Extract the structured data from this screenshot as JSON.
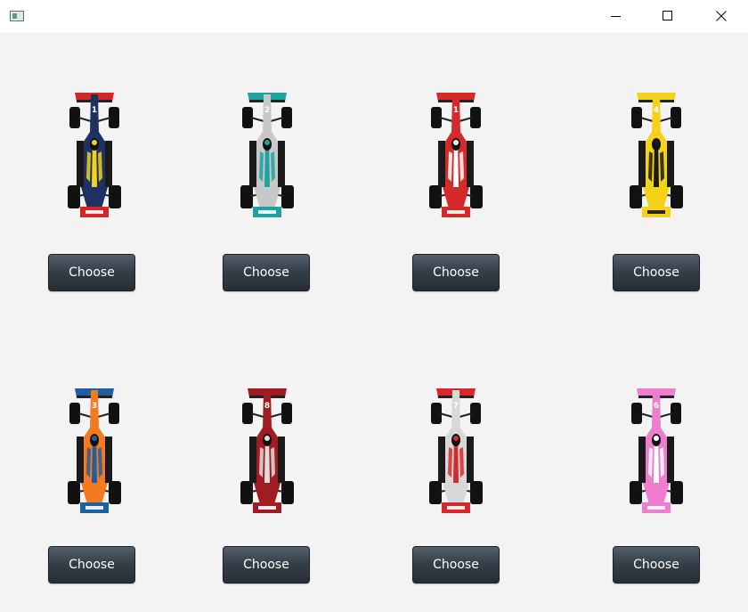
{
  "window": {
    "app_icon": "window-icon",
    "controls": [
      "minimize-icon",
      "maximize-icon",
      "close-icon"
    ]
  },
  "cars": [
    {
      "number": "1",
      "body_color": "#1e3160",
      "accent_color": "#f2d21b",
      "wing_color": "#d6252a",
      "button_label": "Choose"
    },
    {
      "number": "2",
      "body_color": "#c8c8c8",
      "accent_color": "#1fa3a0",
      "wing_color": "#1fa3a0",
      "button_label": "Choose"
    },
    {
      "number": "1",
      "body_color": "#d62a2a",
      "accent_color": "#ffffff",
      "wing_color": "#d62a2a",
      "button_label": "Choose"
    },
    {
      "number": "4",
      "body_color": "#f4d21a",
      "accent_color": "#1a1a1a",
      "wing_color": "#f4d21a",
      "button_label": "Choose"
    },
    {
      "number": "3",
      "body_color": "#f47a21",
      "accent_color": "#1f5f9e",
      "wing_color": "#1f5f9e",
      "button_label": "Choose"
    },
    {
      "number": "8",
      "body_color": "#a01c22",
      "accent_color": "#dddddd",
      "wing_color": "#a01c22",
      "button_label": "Choose"
    },
    {
      "number": "7",
      "body_color": "#d8d8d8",
      "accent_color": "#d62a2a",
      "wing_color": "#d62a2a",
      "button_label": "Choose"
    },
    {
      "number": "6",
      "body_color": "#ee7ccf",
      "accent_color": "#ffffff",
      "wing_color": "#ee7ccf",
      "button_label": "Choose"
    }
  ]
}
